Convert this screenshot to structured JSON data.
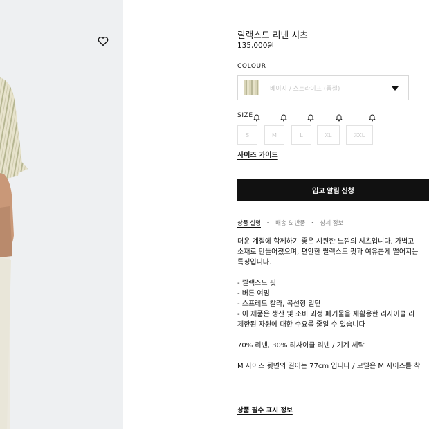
{
  "product": {
    "title": "릴랙스드 리넨 셔츠",
    "price": "135,000원"
  },
  "colour": {
    "label": "COLOUR",
    "selected": "베이지 / 스트라이프 (품절)",
    "swatch_color": "#d9d5b8"
  },
  "size": {
    "label": "SIZE",
    "options": [
      "S",
      "M",
      "L",
      "XL",
      "XXL"
    ],
    "status_icon": "bell-icon"
  },
  "size_guide": "사이즈 가이드",
  "notify_button": "입고 알림 신청",
  "tabs": [
    {
      "label": "상품 설명",
      "active": true
    },
    {
      "label": "배송 & 반품",
      "active": false
    },
    {
      "label": "상세 정보",
      "active": false
    }
  ],
  "tab_separator": "-",
  "description": {
    "intro": [
      "더운 계절에 함께하기 좋은 시원한 느낌의 셔츠입니다. 가볍고",
      "소재로 만들어졌으며, 편안한 릴랙스드 핏과 여유롭게 떨어지는",
      "특징입니다."
    ],
    "features": [
      "- 릴랙스드 핏",
      "- 버튼 여밈",
      "- 스프레드 칼라, 곡선형 밑단",
      "- 이 제품은 생산 및 소비 과정 폐기물을 재활용한 리사이클 리",
      "제한된 자원에 대한 수요를 줄일 수 있습니다"
    ],
    "composition": "70% 리넨, 30% 리사이클 리넨 / 기계 세탁",
    "model_info": "M 사이즈 뒷면의 길이는 77cm 입니다 / 모델은 M 사이즈를 착"
  },
  "required_info_link": "상품 필수 표시 정보",
  "icons": {
    "wishlist": "heart-icon",
    "dropdown": "chevron-down-icon"
  }
}
